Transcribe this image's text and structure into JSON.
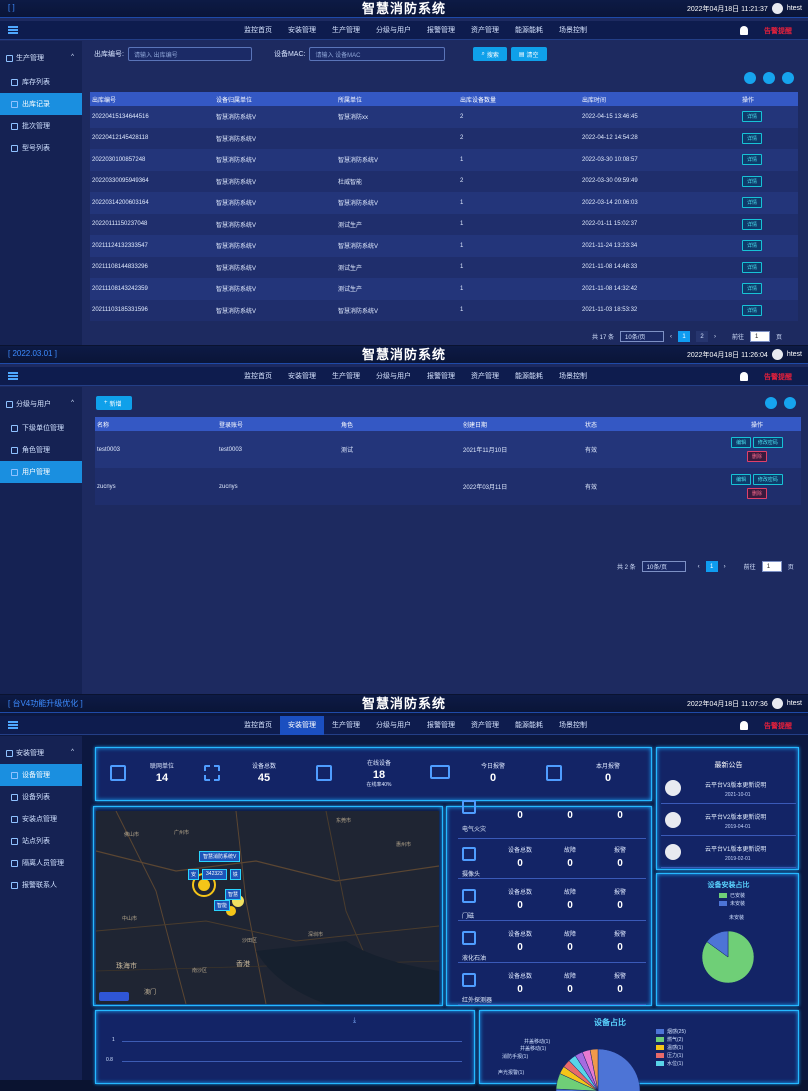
{
  "app_title": "智慧消防系统",
  "user": "htest",
  "alarm_label": "告警提醒",
  "nav": [
    "监控首页",
    "安装管理",
    "生产管理",
    "分级与用户",
    "报警管理",
    "资产管理",
    "能源能耗",
    "场景控制"
  ],
  "panel1": {
    "top_left": "[                  ]",
    "datetime": "2022年04月18日 11:21:37",
    "sidebar_group": "生产管理",
    "sidebar_items": [
      "库存列表",
      "出库记录",
      "批次管理",
      "型号列表"
    ],
    "filter": {
      "label1": "出库编号:",
      "placeholder1": "请输入 出库编号",
      "label2": "设备MAC:",
      "placeholder2": "请输入 设备MAC",
      "search": "搜索",
      "reset": "清空"
    },
    "columns": [
      "出库编号",
      "设备归属单位",
      "所属单位",
      "出库设备数量",
      "出库时间",
      "操作"
    ],
    "rows": [
      [
        "20220415134644516",
        "智慧消防系统V",
        "智慧消防xx",
        "2",
        "2022-04-15 13:46:45",
        "详情"
      ],
      [
        "20220412145428118",
        "智慧消防系统V",
        "",
        "2",
        "2022-04-12 14:54:28",
        "详情"
      ],
      [
        "20220301008572​48",
        "智慧消防系统V",
        "智慧消防系统V",
        "1",
        "2022-03-30 10:08:57",
        "详情"
      ],
      [
        "20220330095949364",
        "智慧消防系统V",
        "杜威智能",
        "2",
        "2022-03-30 09:59:49",
        "详情"
      ],
      [
        "20220314200603164",
        "智慧消防系统V",
        "智慧消防系统V",
        "1",
        "2022-03-14 20:06:03",
        "详情"
      ],
      [
        "20220111150237048",
        "智慧消防系统V",
        "测试生产",
        "1",
        "2022-01-11 15:02:37",
        "详情"
      ],
      [
        "20211124132333547",
        "智慧消防系统V",
        "智慧消防系统V",
        "1",
        "2021-11-24 13:23:34",
        "详情"
      ],
      [
        "20211108144833296",
        "智慧消防系统V",
        "测试生产",
        "1",
        "2021-11-08 14:48:33",
        "详情"
      ],
      [
        "20211108143242359",
        "智慧消防系统V",
        "测试生产",
        "1",
        "2021-11-08 14:32:42",
        "详情"
      ],
      [
        "20211103185331596",
        "智慧消防系统V",
        "智慧消防系统V",
        "1",
        "2021-11-03 18:53:32",
        "详情"
      ]
    ],
    "pager": {
      "total": "共 17 条",
      "size": "10条/页",
      "pages": [
        "1",
        "2"
      ],
      "goto": "前往",
      "page_input": "1",
      "page_suffix": "页"
    }
  },
  "panel2": {
    "top_left": "[          2022.03.01 ]",
    "datetime": "2022年04月18日 11:26:04",
    "sidebar_group": "分级与用户",
    "sidebar_items": [
      "下级单位管理",
      "角色管理",
      "用户管理"
    ],
    "add_button": "新增",
    "columns": [
      "名称",
      "登录账号",
      "角色",
      "创建日期",
      "状态",
      "操作"
    ],
    "rows": [
      {
        "name": "test0003",
        "account": "test0003",
        "role": "测试",
        "date": "2021年11月10日",
        "status": "有效",
        "edit": "编辑",
        "pwd": "修改密码",
        "del": "删除"
      },
      {
        "name": "zucnys",
        "account": "zucnys",
        "role": "",
        "date": "2022年03月11日",
        "status": "有效",
        "edit": "编辑",
        "pwd": "修改密码",
        "del": "删除"
      }
    ],
    "pager": {
      "total": "共 2 条",
      "size": "10条/页",
      "pages": [
        "1"
      ],
      "goto": "前往",
      "page_input": "1",
      "page_suffix": "页"
    }
  },
  "panel3": {
    "top_left": "[ 台V4功能升级优化  ]",
    "datetime": "2022年04月18日 11:07:36",
    "sidebar_group": "安装管理",
    "sidebar_items": [
      "设备管理",
      "设备列表",
      "安装点管理",
      "站点列表",
      "隔离人员管理",
      "报警联系人"
    ],
    "stats": [
      {
        "label": "联网单位",
        "value": "14"
      },
      {
        "label": "设备总数",
        "value": "45"
      },
      {
        "label": "在线设备",
        "value": "18",
        "sub": "在线率40%"
      },
      {
        "label": "今日报警",
        "value": "0"
      },
      {
        "label": "本月报警",
        "value": "0"
      }
    ],
    "map_labels": [
      "智慧消防系统V",
      "安",
      "342323",
      "铁",
      "智能",
      "智慧"
    ],
    "map_places": [
      "东莞市",
      "广州市",
      "佛山市",
      "中山市",
      "珠海市",
      "深圳市",
      "香港",
      "南沙区",
      "沙田区",
      "澳门",
      "惠州市"
    ],
    "devices": [
      {
        "name": "电气火灾",
        "a": "0",
        "b": "0",
        "c": "0"
      },
      {
        "name": "摄像头",
        "la": "设备总数",
        "lb": "故障",
        "lc": "报警",
        "a": "0",
        "b": "0",
        "c": "0"
      },
      {
        "name": "门磁",
        "la": "设备总数",
        "lb": "故障",
        "lc": "报警",
        "a": "0",
        "b": "0",
        "c": "0"
      },
      {
        "name": "液化石油",
        "la": "设备总数",
        "lb": "故障",
        "lc": "报警",
        "a": "0",
        "b": "0",
        "c": "0"
      },
      {
        "name": "红外探测器",
        "la": "设备总数",
        "lb": "故障",
        "lc": "报警",
        "a": "0",
        "b": "0",
        "c": "0"
      }
    ],
    "notice_title": "最新公告",
    "notices": [
      {
        "title": "云平台V3版本更新说明",
        "date": "2021-10-01"
      },
      {
        "title": "云平台V2版本更新说明",
        "date": "2019-04-01"
      },
      {
        "title": "云平台V1版本更新说明",
        "date": "2019-02-01"
      }
    ],
    "install_title": "设备安装占比",
    "install_legend": [
      "已安装",
      "未安装"
    ],
    "install_pie_label": "未安装",
    "device_share_title": "设备占比",
    "share_labels": [
      "井盖移动(1)",
      "井盖移动(1)",
      "消防手报(1)",
      "声光报警(1)"
    ],
    "share_legend": [
      "烟感(25)",
      "燃气(2)",
      "温感(1)",
      "压力(1)",
      "水位(1)"
    ],
    "trend_ticks": [
      "1",
      "0.8"
    ]
  },
  "chart_data": [
    {
      "type": "pie",
      "title": "设备安装占比",
      "categories": [
        "已安装",
        "未安装"
      ],
      "values": [
        85,
        15
      ]
    },
    {
      "type": "pie",
      "title": "设备占比",
      "categories": [
        "烟感",
        "燃气",
        "温感",
        "压力",
        "水位",
        "井盖移动",
        "消防手报",
        "声光报警"
      ],
      "values": [
        25,
        2,
        1,
        1,
        1,
        1,
        1,
        1
      ]
    }
  ],
  "colors": {
    "accent": "#1a8fe0",
    "header": "#3458c4",
    "bg": "#1d2a60",
    "alarm": "#e0203c",
    "pie_installed": "#6fcf77",
    "pie_uninstalled": "#4d74d6"
  }
}
